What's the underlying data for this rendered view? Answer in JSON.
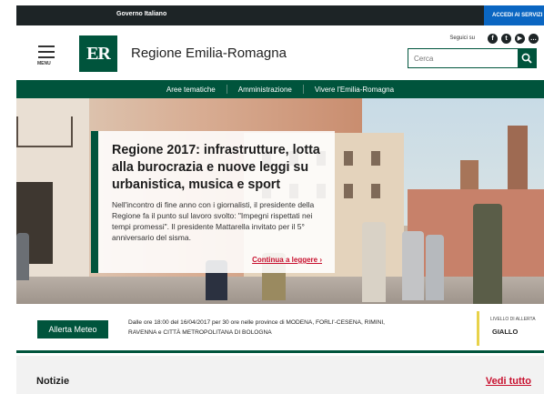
{
  "topbar": {
    "government_label": "Governo Italiano",
    "login_label": "ACCEDI AI SERVIZI"
  },
  "header": {
    "logo_text": "ER",
    "site_title": "Regione Emilia-Romagna",
    "menu_label": "MENU",
    "follow_label": "Seguici su",
    "social_icons": [
      "facebook-icon",
      "twitter-icon",
      "youtube-icon",
      "more-icon"
    ],
    "search_placeholder": "Cerca"
  },
  "nav": {
    "items": [
      "Aree tematiche",
      "Amministrazione",
      "Vivere l'Emilia-Romagna"
    ]
  },
  "hero": {
    "title": "Regione 2017: infrastrutture, lotta alla burocrazia e nuove leggi su urbanistica, musica e sport",
    "text": "Nell'incontro di fine anno con i giornalisti, il presidente della Regione fa il punto sul lavoro svolto: \"Impegni rispettati nei tempi promessi\". Il presidente Mattarella invitato per il 5° anniversario del sisma.",
    "read_more": "Continua a leggere ›"
  },
  "alert": {
    "badge": "Allerta Meteo",
    "message": "Dalle ore 18:00 del 16/04/2017 per 30 ore nelle province di MODENA, FORLI'-CESENA, RIMINI, RAVENNA e CITTÀ METROPOLITANA DI BOLOGNA",
    "level_label": "LIVELLO DI ALLERTA",
    "level_value": "GIALLO",
    "level_color": "#e8d24a"
  },
  "news": {
    "title": "Notizie",
    "see_all": "Vedi tutto"
  },
  "colors": {
    "brand_green": "#00543c",
    "topbar_dark": "#1d2426",
    "login_blue": "#0a66c2",
    "link_red": "#c8102e"
  }
}
